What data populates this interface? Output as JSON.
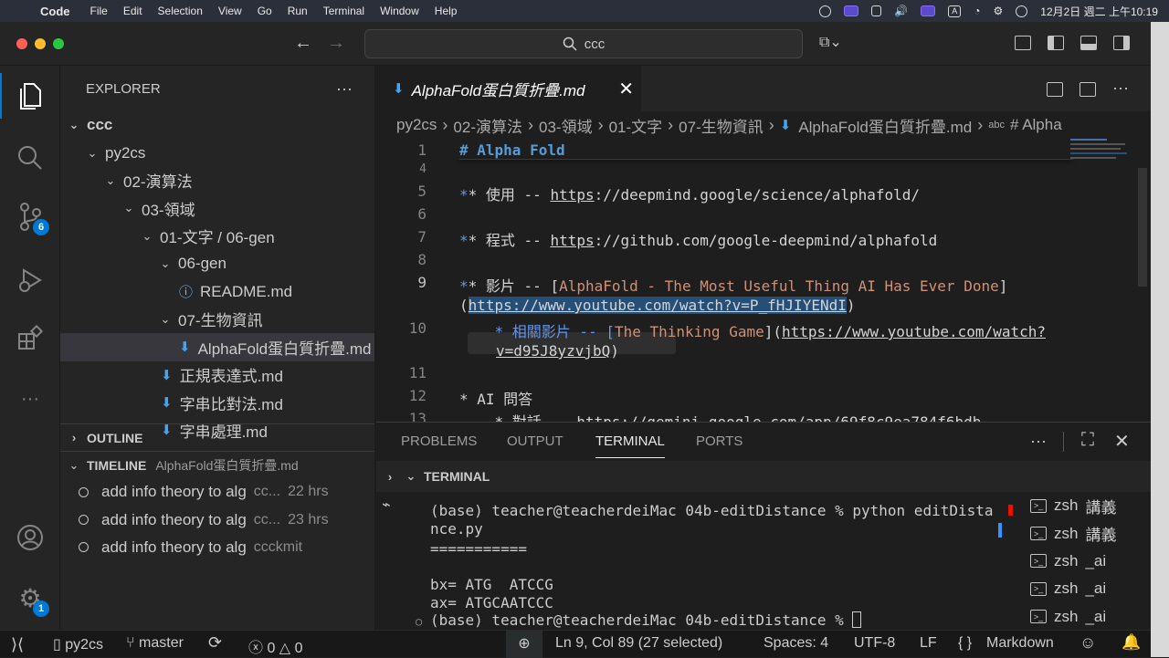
{
  "menubar": {
    "app": "Code",
    "items": [
      "File",
      "Edit",
      "Selection",
      "View",
      "Go",
      "Run",
      "Terminal",
      "Window",
      "Help"
    ],
    "clock": "12月2日 週二 上午10:19",
    "input_source": "A"
  },
  "titlebar": {
    "search": "ccc"
  },
  "activity": {
    "scm_badge": "6",
    "accounts_badge": "1"
  },
  "explorer": {
    "title": "EXPLORER",
    "more": "···",
    "tree": [
      {
        "label": "ccc",
        "depth": 0,
        "chev": "⌄",
        "bold": true
      },
      {
        "label": "py2cs",
        "depth": 1,
        "chev": "⌄"
      },
      {
        "label": "02-演算法",
        "depth": 2,
        "chev": "⌄"
      },
      {
        "label": "03-領域",
        "depth": 3,
        "chev": "⌄"
      },
      {
        "label": "01-文字 / 06-gen",
        "depth": 4,
        "chev": "⌄"
      },
      {
        "label": "06-gen",
        "depth": 5,
        "chev": "⌄"
      },
      {
        "label": "README.md",
        "depth": 6,
        "icon": "ⓘ"
      },
      {
        "label": "07-生物資訊",
        "depth": 5,
        "chev": "⌄"
      },
      {
        "label": "AlphaFold蛋白質折疊.md",
        "depth": 6,
        "icon": "md",
        "selected": true
      },
      {
        "label": "正規表達式.md",
        "depth": 5,
        "icon": "md"
      },
      {
        "label": "字串比對法.md",
        "depth": 5,
        "icon": "md"
      },
      {
        "label": "字串處理.md",
        "depth": 5,
        "icon": "md"
      }
    ]
  },
  "outline": {
    "title": "OUTLINE"
  },
  "timeline": {
    "title": "TIMELINE",
    "file": "AlphaFold蛋白質折疊.md",
    "items": [
      {
        "msg": "add info theory to alg",
        "author": "cc...",
        "time": "22 hrs"
      },
      {
        "msg": "add info theory to alg",
        "author": "cc...",
        "time": "23 hrs"
      },
      {
        "msg": "add info theory to alg",
        "author": "ccckmit",
        "time": ""
      }
    ]
  },
  "editor": {
    "tab": "AlphaFold蛋白質折疊.md",
    "breadcrumb": [
      "py2cs",
      "02-演算法",
      "03-領域",
      "01-文字",
      "07-生物資訊",
      "AlphaFold蛋白質折疊.md",
      "# Alpha"
    ],
    "line_numbers": [
      "1",
      "4",
      "5",
      "6",
      "7",
      "8",
      "9",
      "10",
      "11",
      "12",
      "13"
    ],
    "lines": {
      "l1": "# Alpha Fold",
      "l5_pre": "* 使用 -- ",
      "l5_link_proto": "https",
      "l5_link_rest": "://deepmind.google/science/alphafold/",
      "l7_pre": "* 程式 -- ",
      "l7_link_proto": "https",
      "l7_link_rest": "://github.com/google-deepmind/alphafold",
      "l9_pre": "* 影片 -- [",
      "l9_text": "AlphaFold - The Most Useful Thing AI Has Ever Done",
      "l9_close": "]",
      "l9_paren": "(",
      "l9_url": "https://www.youtube.com/watch?v=P_fHJIYENdI",
      "l9_end": ")",
      "l10_pre": "    * 相關影片 -- [",
      "l10_text": "The Thinking Game",
      "l10_mid": "](",
      "l10_url1": "https://www.youtube.com/watch?",
      "l10_url2": "v=d95J8yzvjbQ",
      "l10_end": ")",
      "l12": "* AI 問答",
      "l13": "    * 對話 -- https://gemini.google.com/app/69f8c9ea784f6bdb"
    }
  },
  "panel": {
    "tabs": [
      "PROBLEMS",
      "OUTPUT",
      "TERMINAL",
      "PORTS"
    ],
    "active": "TERMINAL",
    "more": "···",
    "terminal_title": "TERMINAL",
    "lines": [
      "(base) teacher@teacherdeiMac 04b-editDistance % python editDista",
      "nce.py",
      "===========",
      "",
      "bx= ATG  ATCCG",
      "ax= ATGCAATCCC",
      "(base) teacher@teacherdeiMac 04b-editDistance % "
    ],
    "sessions": [
      {
        "name": "zsh",
        "label": "講義"
      },
      {
        "name": "zsh",
        "label": "講義"
      },
      {
        "name": "zsh",
        "label": "_ai"
      },
      {
        "name": "zsh",
        "label": "_ai"
      },
      {
        "name": "zsh",
        "label": "_ai"
      }
    ]
  },
  "status": {
    "folder": "py2cs",
    "branch": "master",
    "errors": "0",
    "warnings": "0",
    "position": "Ln 9, Col 89 (27 selected)",
    "spaces": "Spaces: 4",
    "encoding": "UTF-8",
    "eol": "LF",
    "language_braces": "{ }",
    "language": "Markdown"
  },
  "colors": {
    "accent": "#0078d4",
    "heading": "#569cd6",
    "link_text": "#ce9178",
    "selection": "#264f78"
  }
}
